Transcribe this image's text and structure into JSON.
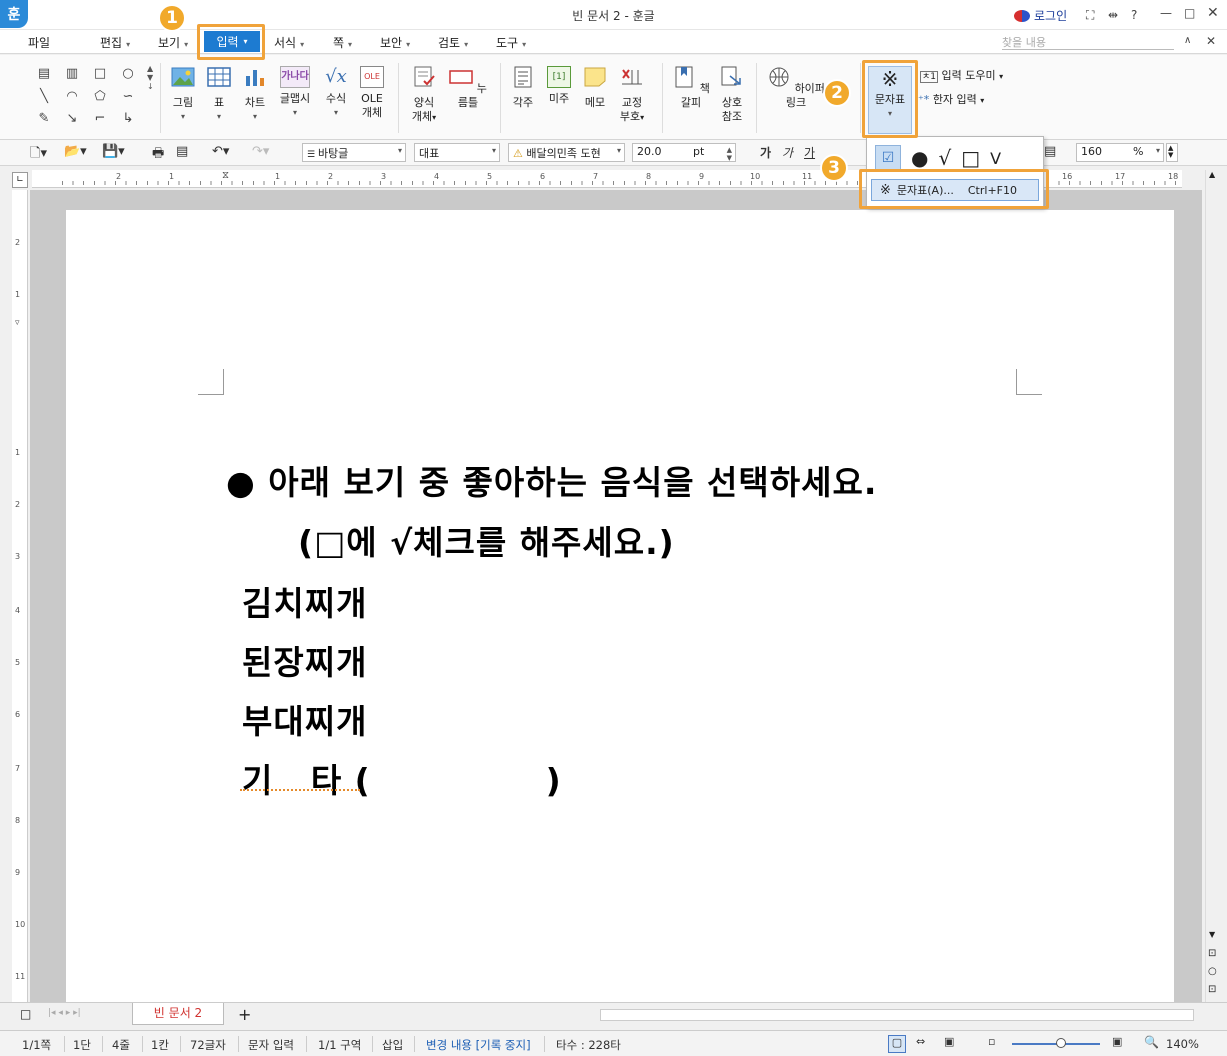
{
  "app": {
    "logo": "훈",
    "title": "빈 문서 2 - 훈글",
    "login": "로그인"
  },
  "menus": [
    {
      "label": "파일",
      "arrow": ""
    },
    {
      "label": "편집",
      "arrow": "▾"
    },
    {
      "label": "보기",
      "arrow": "▾"
    },
    {
      "label": "입력",
      "arrow": "▾"
    },
    {
      "label": "서식",
      "arrow": "▾"
    },
    {
      "label": "쪽",
      "arrow": "▾"
    },
    {
      "label": "보안",
      "arrow": "▾"
    },
    {
      "label": "검토",
      "arrow": "▾"
    },
    {
      "label": "도구",
      "arrow": "▾"
    }
  ],
  "search_placeholder": "찾을 내용",
  "ribbon": {
    "picture": "그림",
    "table": "표",
    "chart": "차트",
    "textart": "글맵시",
    "formula": "수식",
    "ole_line1": "OLE",
    "ole_line2": "개체",
    "form_line1": "양식",
    "form_line2": "개체",
    "pushbutton": "누름틀",
    "footnote": "각주",
    "endnote": "미주",
    "memo": "메모",
    "proof_line1": "교정",
    "proof_line2": "부호",
    "bookmark": "책갈피",
    "crossref_line1": "상호",
    "crossref_line2": "참조",
    "hyperlink": "하이퍼링크",
    "charmap": "문자표",
    "input_helper": "입력 도우미",
    "hanja": "한자 입력",
    "ole_badge": "OLE",
    "textart_badge": "가나다",
    "endnote_badge": "[1]"
  },
  "format": {
    "style": "바탕글",
    "font_type": "대표",
    "font_name": "배달의민족 도현",
    "font_size": "20.0",
    "unit": "pt",
    "zoom": "160",
    "zoom_unit": "%"
  },
  "dropdown": {
    "symbols": [
      "☑",
      "●",
      "√",
      "□",
      "V"
    ],
    "item_icon": "※",
    "item_label": "문자표(A)...",
    "item_shortcut": "Ctrl+F10"
  },
  "badges": [
    "1",
    "2",
    "3"
  ],
  "document": {
    "line1": "● 아래 보기 중 좋아하는 음식을 선택하세요.",
    "line2": "(□에 √체크를 해주세요.)",
    "items": [
      "김치찌개",
      "된장찌개",
      "부대찌개"
    ],
    "other": "기   타 (              )"
  },
  "ruler": {
    "h": [
      "2",
      "1",
      "",
      "1",
      "2",
      "3",
      "4",
      "5",
      "6",
      "7",
      "8",
      "9",
      "10",
      "11",
      "12",
      "13",
      "14",
      "15",
      "16",
      "17",
      "18"
    ],
    "v": [
      "2",
      "1",
      "",
      "1",
      "2",
      "3",
      "4",
      "5",
      "6",
      "7",
      "8",
      "9",
      "10",
      "11"
    ]
  },
  "tab": {
    "name": "빈 문서 2",
    "add": "+"
  },
  "status": {
    "page": "1/1쪽",
    "col": "1단",
    "line": "4줄",
    "cell": "1칸",
    "chars": "72글자",
    "mode": "문자 입력",
    "section": "1/1 구역",
    "insert": "삽입",
    "track": "변경 내용 [기록 중지]",
    "keys": "타수 : 228타",
    "zoom": "140%"
  }
}
